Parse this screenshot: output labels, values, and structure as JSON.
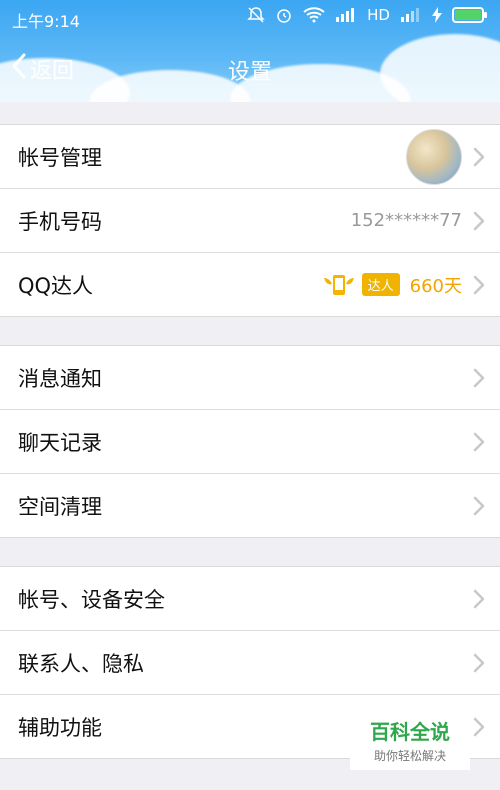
{
  "status_bar": {
    "time": "上午9:14",
    "network": "HD"
  },
  "nav": {
    "back_label": "返回",
    "title": "设置"
  },
  "groups": [
    {
      "items": [
        {
          "label": "帐号管理"
        },
        {
          "label": "手机号码",
          "value": "152******77"
        },
        {
          "label": "QQ达人",
          "badge": "达人",
          "value": "660天"
        }
      ]
    },
    {
      "items": [
        {
          "label": "消息通知"
        },
        {
          "label": "聊天记录"
        },
        {
          "label": "空间清理"
        }
      ]
    },
    {
      "items": [
        {
          "label": "帐号、设备安全"
        },
        {
          "label": "联系人、隐私"
        },
        {
          "label": "辅助功能"
        }
      ]
    }
  ],
  "watermark": {
    "title": "百科全说",
    "subtitle": "助你轻松解决"
  },
  "colors": {
    "header_blue": "#3ba6f2",
    "badge_orange": "#f5a300",
    "watermark_green": "#2ea84a"
  }
}
